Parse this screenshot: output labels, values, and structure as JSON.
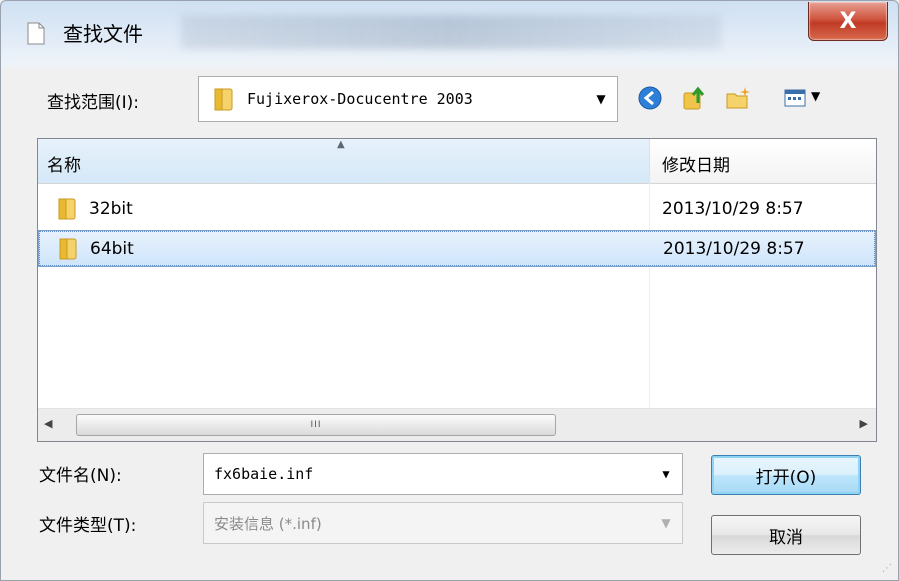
{
  "window": {
    "title": "查找文件",
    "close_label": "X"
  },
  "lookin": {
    "label": "查找范围(I):",
    "value": "Fujixerox-Docucentre 2003"
  },
  "toolbar": [
    "back-icon",
    "up-folder-icon",
    "new-folder-icon",
    "view-menu-icon"
  ],
  "file_list": {
    "columns": {
      "name": "名称",
      "date": "修改日期"
    },
    "rows": [
      {
        "name": "32bit",
        "date": "2013/10/29 8:57",
        "selected": false
      },
      {
        "name": "64bit",
        "date": "2013/10/29 8:57",
        "selected": true
      }
    ],
    "scroll_thumb": "III"
  },
  "filename": {
    "label": "文件名(N):",
    "value": "fx6baie.inf"
  },
  "filetype": {
    "label": "文件类型(T):",
    "value": "安装信息 (*.inf)"
  },
  "buttons": {
    "open": "打开(O)",
    "cancel": "取消"
  },
  "colors": {
    "close": "#c8452e",
    "selection": "#cfe5fb",
    "folder": "#e8b931"
  }
}
